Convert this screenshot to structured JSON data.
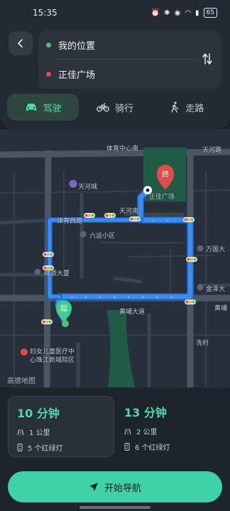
{
  "status_bar": {
    "time": "15:35",
    "battery": "65",
    "icons": [
      "alarm-icon",
      "bluetooth-icon",
      "location-icon",
      "wifi-icon",
      "signal-icon"
    ]
  },
  "route": {
    "origin": "我的位置",
    "destination": "正佳广场",
    "origin_color": "#4fc36a",
    "destination_color": "#e24b4b"
  },
  "modes": [
    {
      "label": "驾驶",
      "icon": "car-icon",
      "active": true
    },
    {
      "label": "骑行",
      "icon": "bicycle-icon",
      "active": false
    },
    {
      "label": "走路",
      "icon": "walking-icon",
      "active": false
    }
  ],
  "map": {
    "labels": {
      "tiyu_center_south": "体育中心南",
      "tianhe_big": "天河路",
      "tianhe_city": "天河城",
      "tiyu_west": "体育西路",
      "tianhe_south": "天河南",
      "zhengjia": "正佳广场",
      "liuyun": "六运小区",
      "wanguo": "万国大",
      "fengyuan": "峰源大厦",
      "jinze": "金泽大",
      "huangpu_avenue": "黄埔大道",
      "huangpu_right": "黄埔",
      "xiancun": "冼村",
      "hospital_line1": "妇女儿童医疗中",
      "hospital_line2": "心珠江新城院区",
      "amap": "高德地图"
    },
    "start_marker": "起",
    "end_marker": "终",
    "route_color": "#3b8cf0"
  },
  "routes": [
    {
      "duration": "10 分钟",
      "distance": "1 公里",
      "lights": "5 个红绿灯",
      "selected": true
    },
    {
      "duration": "13 分钟",
      "distance": "2 公里",
      "lights": "6 个红绿灯",
      "selected": false
    }
  ],
  "start_button": "开始导航",
  "colors": {
    "accent": "#3fd2a7",
    "accent_text": "#4fd9ad",
    "panel": "#242a33",
    "map_bg": "#27303a"
  }
}
